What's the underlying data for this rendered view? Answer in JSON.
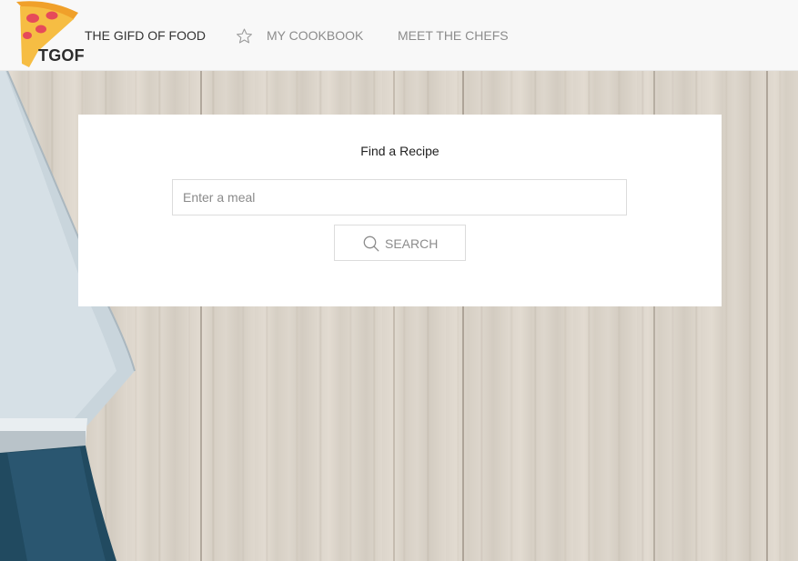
{
  "navbar": {
    "logo_text": "TGOF",
    "logo_icon": "pizza-slice-icon",
    "brand": "THE GIFD OF FOOD",
    "links": [
      {
        "label": "MY COOKBOOK",
        "icon": "star-icon"
      },
      {
        "label": "MEET THE CHEFS"
      }
    ]
  },
  "search_card": {
    "title": "Find a Recipe",
    "input_placeholder": "Enter a meal",
    "input_value": "",
    "button_label": "SEARCH",
    "button_icon": "search-icon"
  },
  "colors": {
    "navbar_bg": "#f8f8f8",
    "nav_link": "#8c8c8c",
    "brand_text": "#333333",
    "card_bg": "#ffffff",
    "pizza_crust": "#f4b23a",
    "pizza_topping": "#e64a5a"
  }
}
